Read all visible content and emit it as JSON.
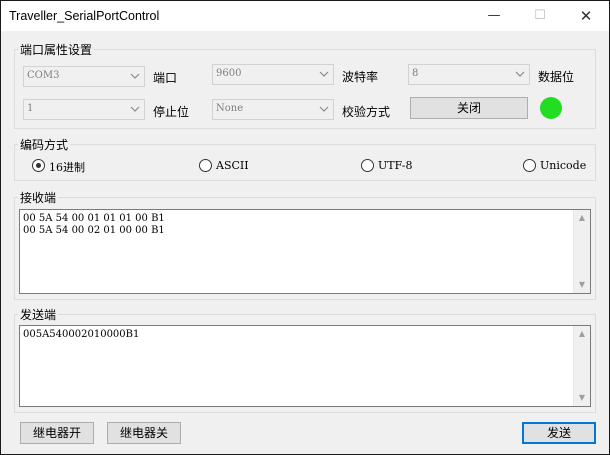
{
  "window": {
    "title": "Traveller_SerialPortControl"
  },
  "controls": {
    "minimize_glyph": "—",
    "maximize_glyph": "☐",
    "close_glyph": "✕"
  },
  "port_settings": {
    "group_label": "端口属性设置",
    "port_value": "COM3",
    "port_label": "端口",
    "baud_value": "9600",
    "baud_label": "波特率",
    "databits_value": "8",
    "databits_label": "数据位",
    "stopbits_value": "1",
    "stopbits_label": "停止位",
    "parity_value": "None",
    "parity_label": "校验方式",
    "toggle_button": "关闭",
    "status_color": "#22dd22"
  },
  "encoding": {
    "group_label": "编码方式",
    "options": [
      "16进制",
      "ASCII",
      "UTF-8",
      "Unicode"
    ],
    "selected": "16进制"
  },
  "receive": {
    "group_label": "接收端",
    "lines": [
      "00 5A 54 00 01 01 01 00 B1",
      "00 5A 54 00 02 01 00 00 B1"
    ]
  },
  "send": {
    "group_label": "发送端",
    "text": "005A540002010000B1"
  },
  "buttons": {
    "relay_on": "继电器开",
    "relay_off": "继电器关",
    "send": "发送"
  }
}
